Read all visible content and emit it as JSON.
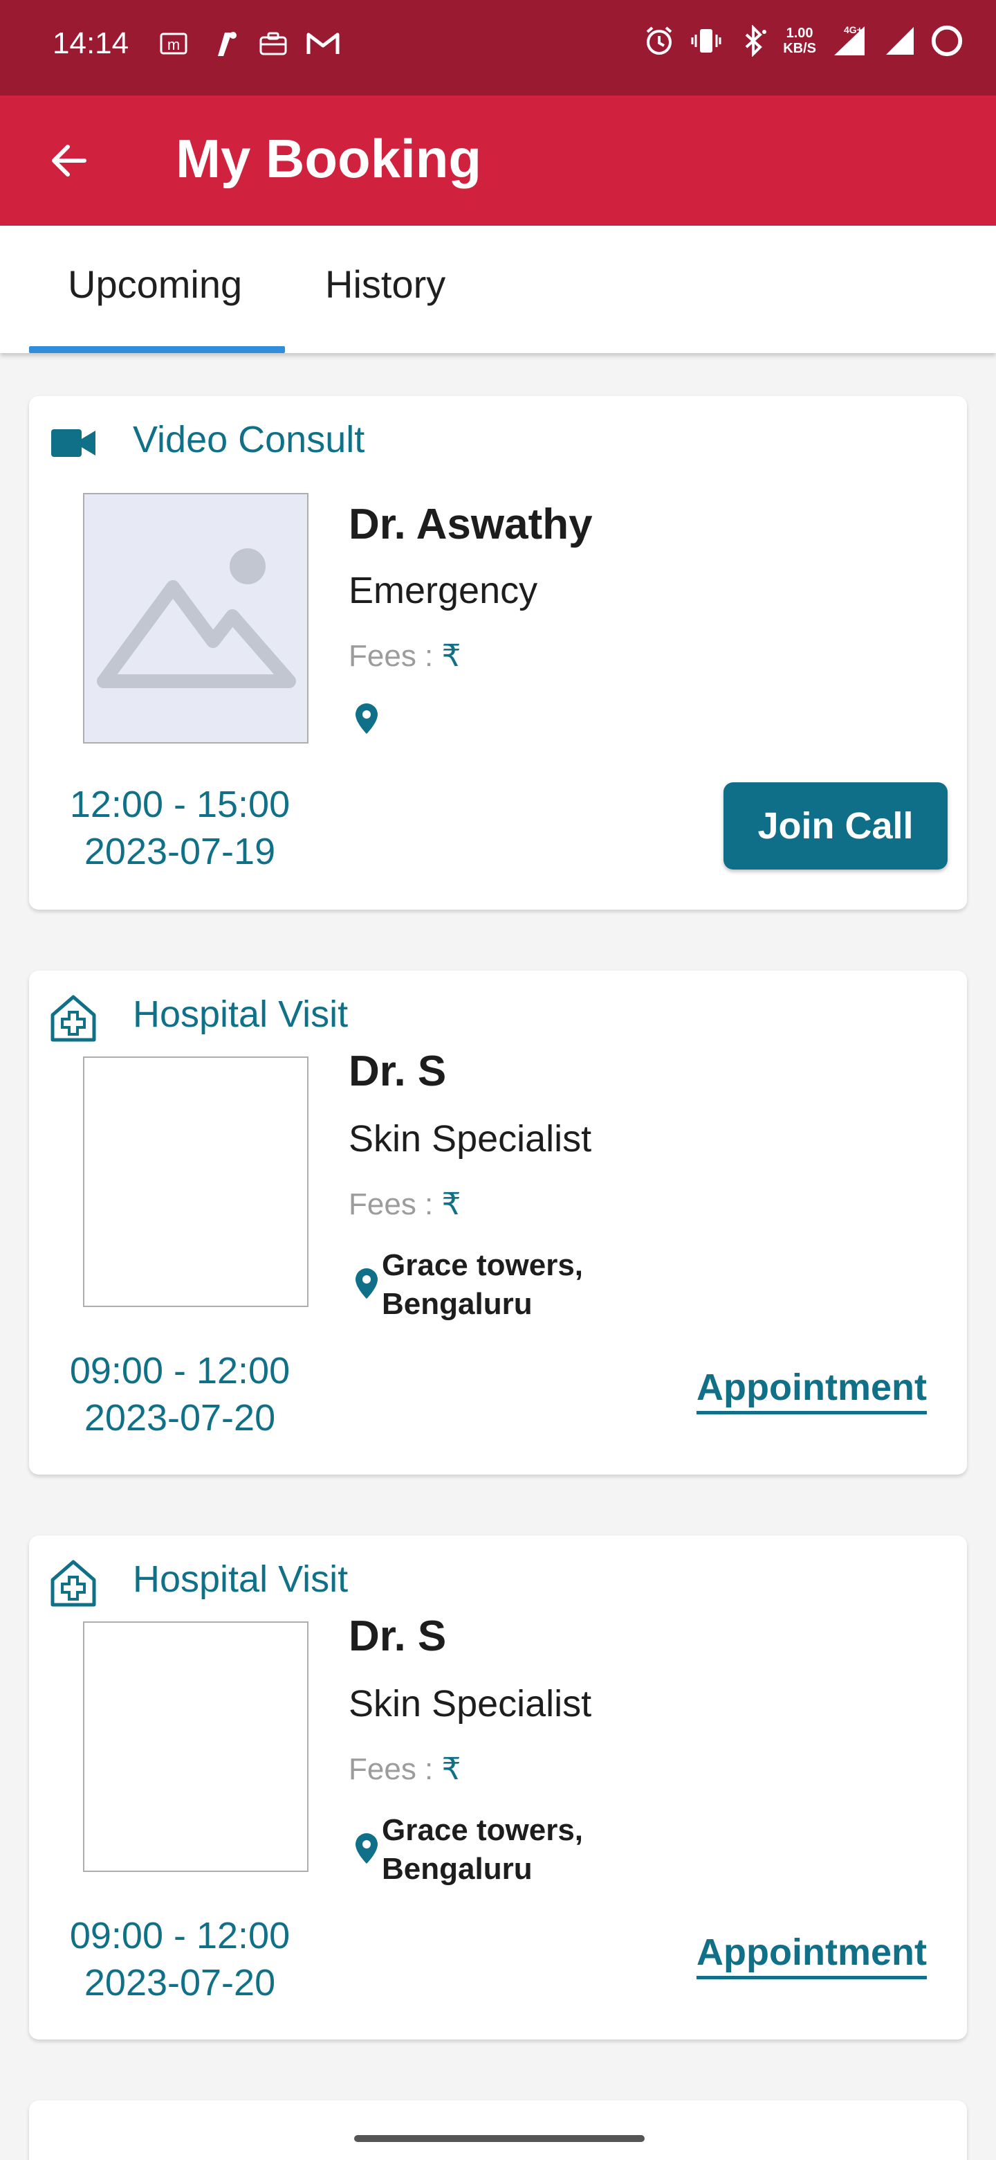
{
  "status_bar": {
    "time": "14:14",
    "speed_value": "1.00",
    "speed_unit": "KB/S",
    "network": "4G+",
    "left_icons": [
      "m-box-icon",
      "app-i-icon",
      "briefcase-icon",
      "gmail-icon"
    ],
    "right_icons": [
      "alarm-icon",
      "vibrate-icon",
      "bluetooth-icon",
      "signal-icon",
      "battery-ring-icon"
    ]
  },
  "app_bar": {
    "title": "My Booking",
    "back_icon": "arrow-left-icon"
  },
  "tabs": [
    {
      "label": "Upcoming",
      "selected": true
    },
    {
      "label": "History",
      "selected": false
    }
  ],
  "colors": {
    "status_bar": "#9a1a32",
    "app_bar": "#d0223f",
    "accent_teal": "#0f7088",
    "tab_indicator": "#2f8ddb"
  },
  "bookings": [
    {
      "type": "Video Consult",
      "type_icon": "video-camera-icon",
      "doctor": "Dr. Aswathy",
      "specialty": "Emergency",
      "fees_label": "Fees :",
      "currency": "₹",
      "address_line1": "",
      "address_line2": "",
      "time": "12:00 - 15:00",
      "date": "2023-07-19",
      "action": "Join Call"
    },
    {
      "type": "Hospital Visit",
      "type_icon": "hospital-icon",
      "doctor": "Dr. S",
      "specialty": "Skin Specialist",
      "fees_label": "Fees :",
      "currency": "₹",
      "address_line1": "Grace towers,",
      "address_line2": "Bengaluru",
      "time": "09:00 - 12:00",
      "date": "2023-07-20",
      "action": "Appointment"
    },
    {
      "type": "Hospital Visit",
      "type_icon": "hospital-icon",
      "doctor": "Dr. S",
      "specialty": "Skin Specialist",
      "fees_label": "Fees :",
      "currency": "₹",
      "address_line1": "Grace towers,",
      "address_line2": "Bengaluru",
      "time": "09:00 - 12:00",
      "date": "2023-07-20",
      "action": "Appointment"
    }
  ]
}
